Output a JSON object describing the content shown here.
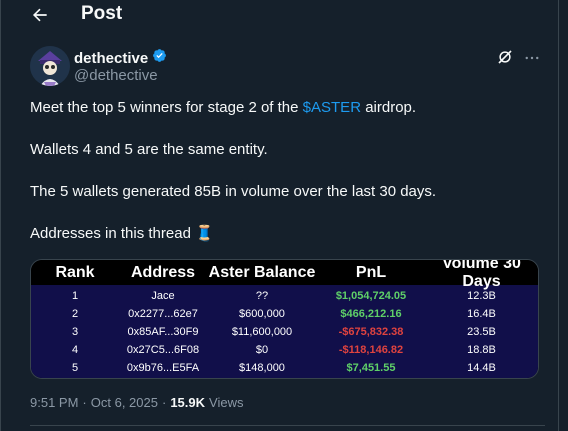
{
  "header": {
    "title": "Post"
  },
  "author": {
    "name": "dethective",
    "handle": "@dethective"
  },
  "tweet": {
    "line1_prefix": "Meet the top 5 winners for stage 2 of the ",
    "cashtag": "$ASTER",
    "line1_suffix": " airdrop.",
    "line2": "Wallets 4 and 5 are the same entity.",
    "line3": "The 5 wallets generated 85B in volume over the last 30 days.",
    "line4": "Addresses in this thread 🧵"
  },
  "table": {
    "columns": [
      "Rank",
      "Address",
      "Aster Balance",
      "PnL",
      "Volume 30 Days"
    ],
    "rows": [
      {
        "rank": "1",
        "address": "Jace",
        "balance": "??",
        "pnl": "$1,054,724.05",
        "volume": "12.3B"
      },
      {
        "rank": "2",
        "address": "0x2277...62e7",
        "balance": "$600,000",
        "pnl": "$466,212.16",
        "volume": "16.4B"
      },
      {
        "rank": "3",
        "address": "0x85AF...30F9",
        "balance": "$11,600,000",
        "pnl": "-$675,832.38",
        "volume": "23.5B"
      },
      {
        "rank": "4",
        "address": "0x27C5...6F08",
        "balance": "$0",
        "pnl": "-$118,146.82",
        "volume": "18.8B"
      },
      {
        "rank": "5",
        "address": "0x9b76...E5FA",
        "balance": "$148,000",
        "pnl": "$7,451.55",
        "volume": "14.4B"
      }
    ]
  },
  "meta": {
    "time": "9:51 PM",
    "date": "Oct 6, 2025",
    "views_count": "15.9K",
    "views_label": "Views"
  },
  "colors": {
    "background": "#15202b",
    "accent": "#1d9bf0",
    "positive": "#5fd068",
    "negative": "#e0433f",
    "table_body": "#110f4a"
  }
}
